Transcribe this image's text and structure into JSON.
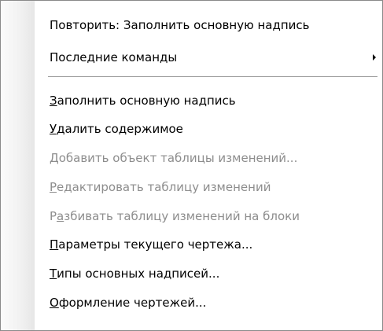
{
  "menu": {
    "items": [
      {
        "before": "",
        "key": "",
        "after": "Повторить: Заполнить основную надпись",
        "enabled": true
      },
      {
        "before": "",
        "key": "",
        "after": "Последние команды",
        "enabled": true,
        "submenu": true
      },
      {
        "before": "",
        "key": "З",
        "after": "аполнить основную надпись",
        "enabled": true
      },
      {
        "before": "",
        "key": "У",
        "after": "далить содержимое",
        "enabled": true
      },
      {
        "before": "",
        "key": "Д",
        "after": "обавить объект таблицы изменений...",
        "enabled": false
      },
      {
        "before": "",
        "key": "Р",
        "after": "едактировать таблицу изменений",
        "enabled": false
      },
      {
        "before": "Р",
        "key": "а",
        "after": "збивать таблицу изменений на блоки",
        "enabled": false
      },
      {
        "before": "",
        "key": "П",
        "after": "араметры текущего чертежа...",
        "enabled": true
      },
      {
        "before": "",
        "key": "Т",
        "after": "ипы основных надписей...",
        "enabled": true
      },
      {
        "before": "",
        "key": "О",
        "after": "формление чертежей...",
        "enabled": true
      }
    ]
  },
  "icons": {
    "submenu_arrow": "chevron-right-icon"
  },
  "colors": {
    "text": "#000000",
    "disabled_text": "#8d8d8d",
    "separator": "#9a9a9a"
  }
}
